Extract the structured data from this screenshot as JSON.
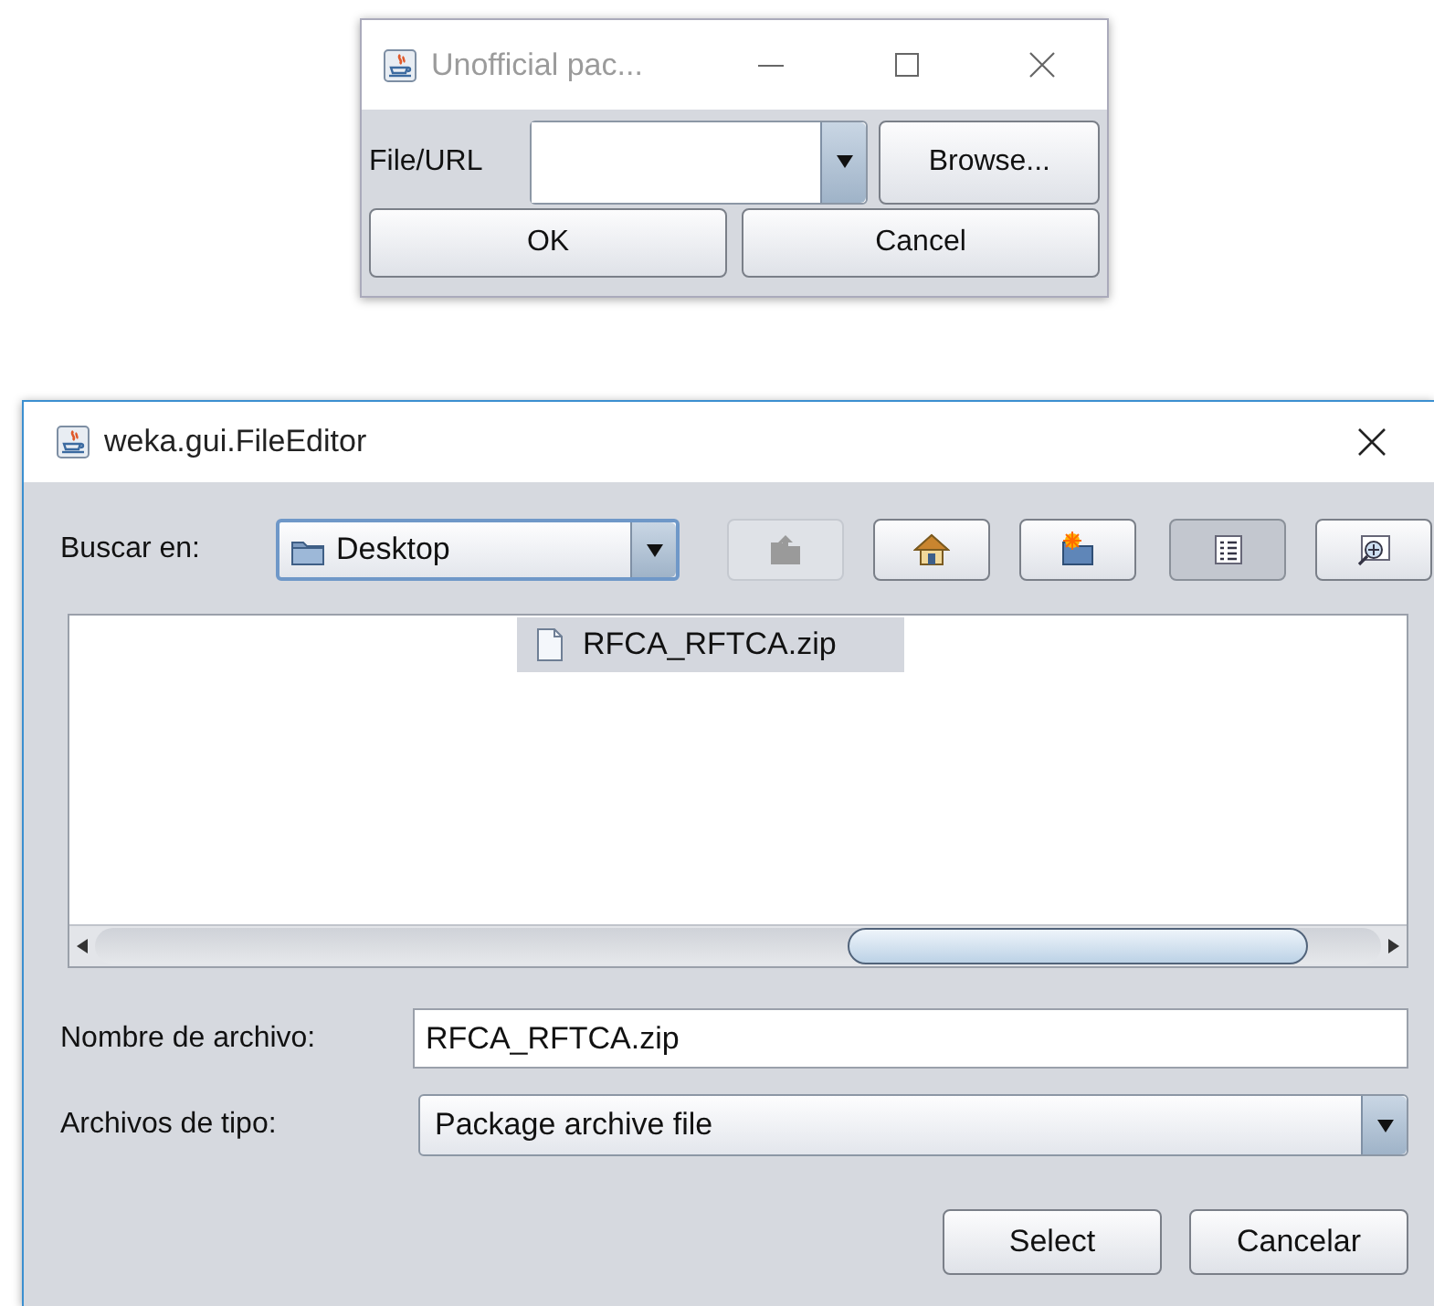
{
  "small_dialog": {
    "title": "Unofficial pac...",
    "file_label": "File/URL",
    "browse_button": "Browse...",
    "buttons": [
      "OK",
      "Cancel"
    ]
  },
  "file_dialog": {
    "title": "weka.gui.FileEditor",
    "look_in_label": "Buscar en:",
    "look_in_value": "Desktop",
    "toolbar": [
      {
        "kind": "up-folder",
        "disabled": true,
        "selected": false
      },
      {
        "kind": "home",
        "disabled": false,
        "selected": false
      },
      {
        "kind": "new-folder",
        "disabled": false,
        "selected": false
      },
      {
        "kind": "list-view",
        "disabled": false,
        "selected": true
      },
      {
        "kind": "details-view",
        "disabled": false,
        "selected": false
      }
    ],
    "files": [
      {
        "name": "RFCA_RFTCA.zip",
        "selected": true
      }
    ],
    "file_name_label": "Nombre de archivo:",
    "file_name_value": "RFCA_RFTCA.zip",
    "file_type_label": "Archivos de tipo:",
    "file_type_value": "Package archive file",
    "buttons": [
      "Select",
      "Cancelar"
    ]
  }
}
